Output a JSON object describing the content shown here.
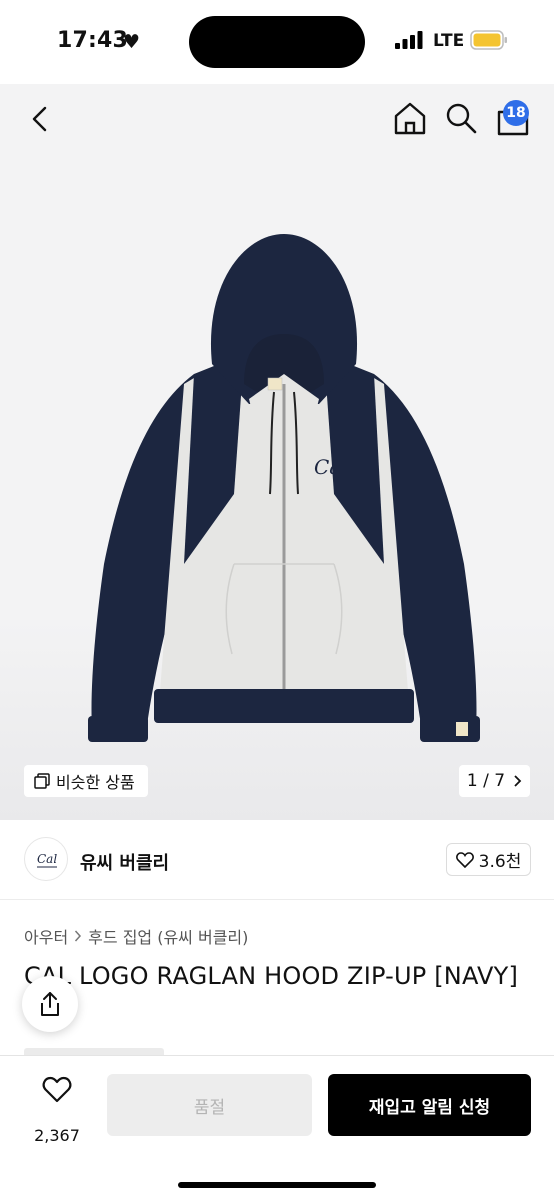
{
  "status_bar": {
    "time": "17:43",
    "network": "LTE"
  },
  "nav": {
    "cart_count": "18"
  },
  "gallery": {
    "similar_label": "비슷한 상품",
    "page_indicator": "1 / 7",
    "logo_text": "Cal"
  },
  "brand": {
    "name": "유씨 버클리",
    "likes": "3.6천"
  },
  "breadcrumb": {
    "category": "아우터",
    "subcategory": "후드 집업 (유씨 버클리)"
  },
  "product": {
    "title": "CAL LOGO RAGLAN HOOD ZIP-UP [NAVY]"
  },
  "actions": {
    "wish_count": "2,367",
    "soldout_label": "품절",
    "restock_label": "재입고 알림 신청"
  },
  "colors": {
    "navy": "#1c2640",
    "body": "#e6e6e4",
    "badge": "#2f6ee8"
  }
}
